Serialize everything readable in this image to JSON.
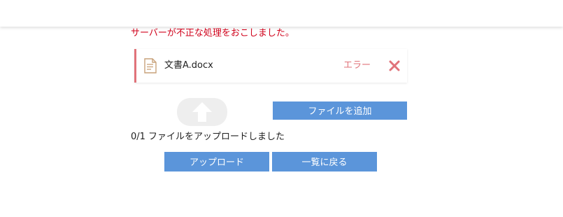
{
  "error": {
    "message": "サーバーが不正な処理をおこしました。"
  },
  "file": {
    "name": "文書A.docx",
    "status": "エラー",
    "icon": "document-icon",
    "remove_icon": "close-icon"
  },
  "upload_area": {
    "icon": "upload-arrow-icon"
  },
  "buttons": {
    "add_file": "ファイルを追加",
    "upload": "アップロード",
    "back_to_list": "一覧に戻る"
  },
  "progress": {
    "text": "0/1 ファイルをアップロードしました"
  },
  "colors": {
    "error_text": "#d0021b",
    "status_error": "#e0737a",
    "button_bg": "#5b95da"
  }
}
